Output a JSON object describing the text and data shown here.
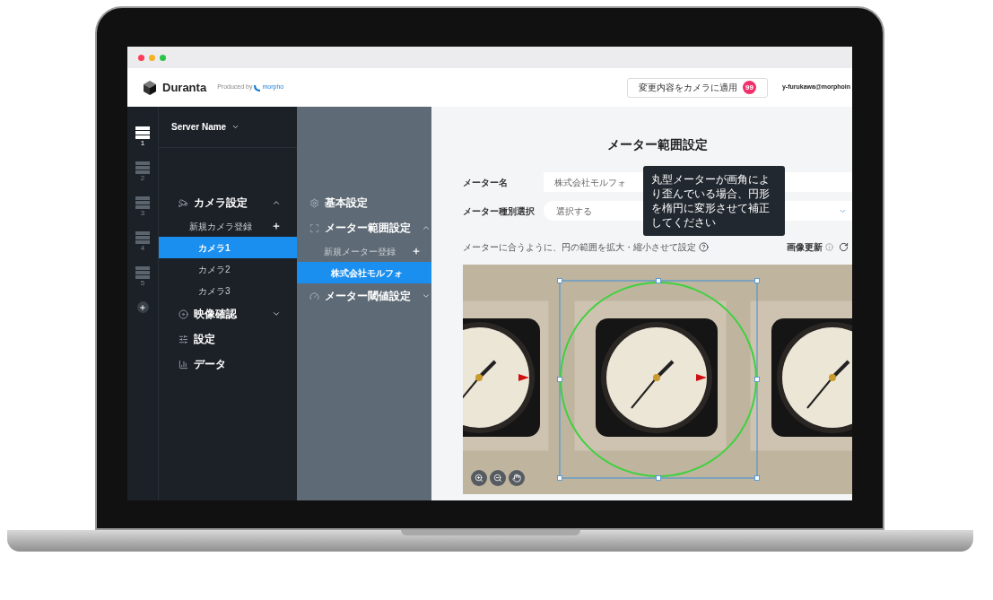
{
  "header": {
    "logo": "Duranta",
    "produced_by": "Produced by",
    "partner": "morpho",
    "apply_button": "変更内容をカメラに適用",
    "apply_badge": "99",
    "user": "y-furukawa@morphoin"
  },
  "servers": [
    {
      "label": "1",
      "selected": true
    },
    {
      "label": "2",
      "selected": false
    },
    {
      "label": "3",
      "selected": false
    },
    {
      "label": "4",
      "selected": false
    },
    {
      "label": "5",
      "selected": false
    }
  ],
  "sidebar": {
    "server_name": "Server Name",
    "items": [
      {
        "kind": "group",
        "label": "カメラ設定",
        "expanded": true,
        "children": [
          {
            "kind": "add",
            "label": "新規カメラ登録",
            "selected": false
          },
          {
            "kind": "item",
            "label": "カメラ1",
            "selected": true
          },
          {
            "kind": "item",
            "label": "カメラ2",
            "selected": false
          },
          {
            "kind": "item",
            "label": "カメラ3",
            "selected": false
          }
        ]
      },
      {
        "kind": "group",
        "label": "映像確認",
        "expanded": false
      },
      {
        "kind": "link",
        "label": "設定"
      },
      {
        "kind": "link",
        "label": "データ"
      }
    ]
  },
  "meter_menu": {
    "items": [
      {
        "kind": "link",
        "label": "基本設定"
      },
      {
        "kind": "group",
        "label": "メーター範囲設定",
        "expanded": true,
        "children": [
          {
            "kind": "add",
            "label": "新規メーター登録",
            "selected": false
          },
          {
            "kind": "item",
            "label": "株式会社モルフォ",
            "selected": true
          }
        ]
      },
      {
        "kind": "group",
        "label": "メーター閾値設定",
        "expanded": false
      }
    ]
  },
  "main": {
    "title": "メーター範囲設定",
    "fields": [
      {
        "kind": "text",
        "label": "メーター名",
        "value": "株式会社モルフォ"
      },
      {
        "kind": "select",
        "label": "メーター種別選択",
        "value": "選択する"
      }
    ],
    "hint": "メーターに合うように、円の範囲を拡大・縮小させて設定",
    "tooltip": "丸型メーターが画角により歪んでいる場合、円形を楕円に変形させて補正してください",
    "refresh_label": "画像更新"
  }
}
